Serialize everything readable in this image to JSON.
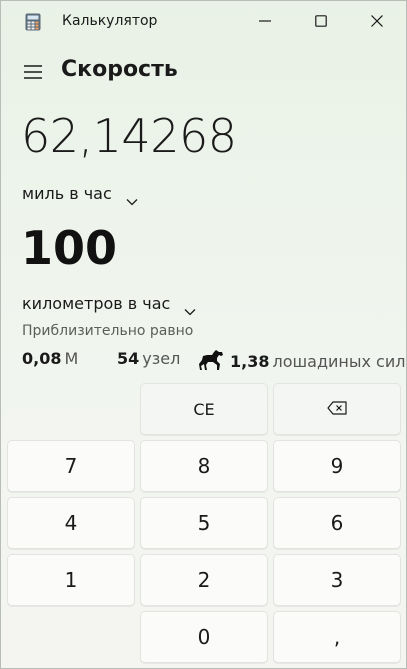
{
  "window": {
    "app_title": "Калькулятор",
    "app_icon": "calculator-icon",
    "controls": [
      "minimize-icon",
      "maximize-icon",
      "close-icon"
    ]
  },
  "header": {
    "menu_icon": "hamburger-menu-icon",
    "mode_title": "Скорость"
  },
  "converter": {
    "from_value": "62,14268",
    "from_unit": "миль в час",
    "to_value": "100",
    "to_unit": "километров в час",
    "approx_label": "Приблизительно равно",
    "equivalents": [
      {
        "value": "0,08",
        "unit": "М"
      },
      {
        "value": "54",
        "unit": "узел"
      },
      {
        "icon": "horse-icon",
        "value": "1,38",
        "unit": "лошадиных сил"
      }
    ]
  },
  "keypad": {
    "ce": "CE",
    "backspace_icon": "backspace-icon",
    "digits": [
      "7",
      "8",
      "9",
      "4",
      "5",
      "6",
      "1",
      "2",
      "3"
    ],
    "zero": "0",
    "decimal": ","
  },
  "colors": {
    "background_top": "#e9f2e6",
    "key_background": "#fbfbfa",
    "text": "#1a1a1a"
  }
}
